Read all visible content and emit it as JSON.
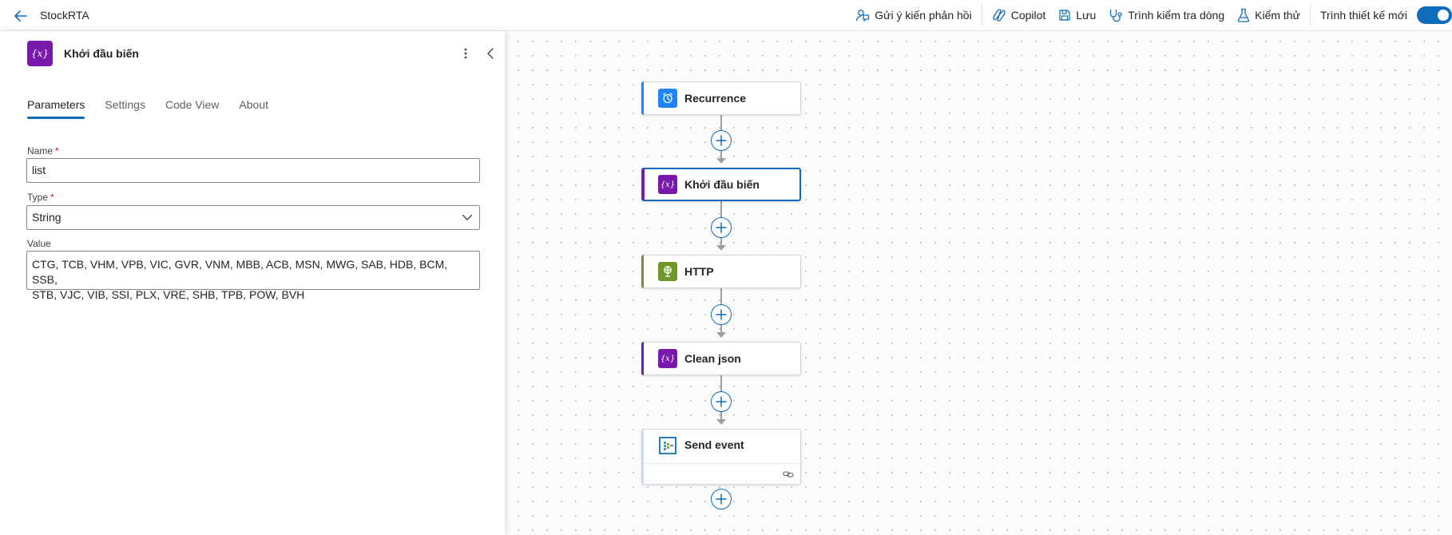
{
  "header": {
    "app_title": "StockRTA",
    "toolbar": {
      "feedback": "Gửi ý kiến phản hồi",
      "copilot": "Copilot",
      "save": "Lưu",
      "flow_checker": "Trình kiểm tra dòng",
      "test": "Kiểm thử",
      "new_designer": "Trình thiết kế mới"
    },
    "new_designer_toggle_on": true
  },
  "panel": {
    "title": "Khởi đầu biến",
    "icon_text": "{x}",
    "tabs": [
      {
        "label": "Parameters",
        "active": true
      },
      {
        "label": "Settings",
        "active": false
      },
      {
        "label": "Code View",
        "active": false
      },
      {
        "label": "About",
        "active": false
      }
    ],
    "fields": {
      "name": {
        "label": "Name",
        "required_mark": "*",
        "value": "list"
      },
      "type": {
        "label": "Type",
        "required_mark": "*",
        "value": "String"
      },
      "value": {
        "label": "Value",
        "line1": "CTG, TCB, VHM, VPB, VIC, GVR, VNM, MBB, ACB, MSN, MWG, SAB, HDB, BCM, SSB,",
        "line2": "STB, VJC, VIB, SSI, PLX, VRE, SHB, TPB, POW, BVH"
      }
    }
  },
  "flow": {
    "steps": [
      {
        "label": "Recurrence",
        "icon": "clock-icon",
        "color": "#1f85ff"
      },
      {
        "label": "Khởi đầu biến",
        "icon": "variable-icon",
        "icon_text": "{x}",
        "color": "#7719aa",
        "selected": true
      },
      {
        "label": "HTTP",
        "icon": "http-globe-icon",
        "color": "#709727"
      },
      {
        "label": "Clean json",
        "icon": "variable-icon",
        "icon_text": "{x}",
        "color": "#7719aa"
      },
      {
        "label": "Send event",
        "icon": "event-hub-icon",
        "color": "#0f6cbd"
      }
    ]
  },
  "colors": {
    "accent": "#0f6cbd",
    "variable": "#7719aa",
    "http": "#709727",
    "recurrence": "#1f85ff"
  }
}
